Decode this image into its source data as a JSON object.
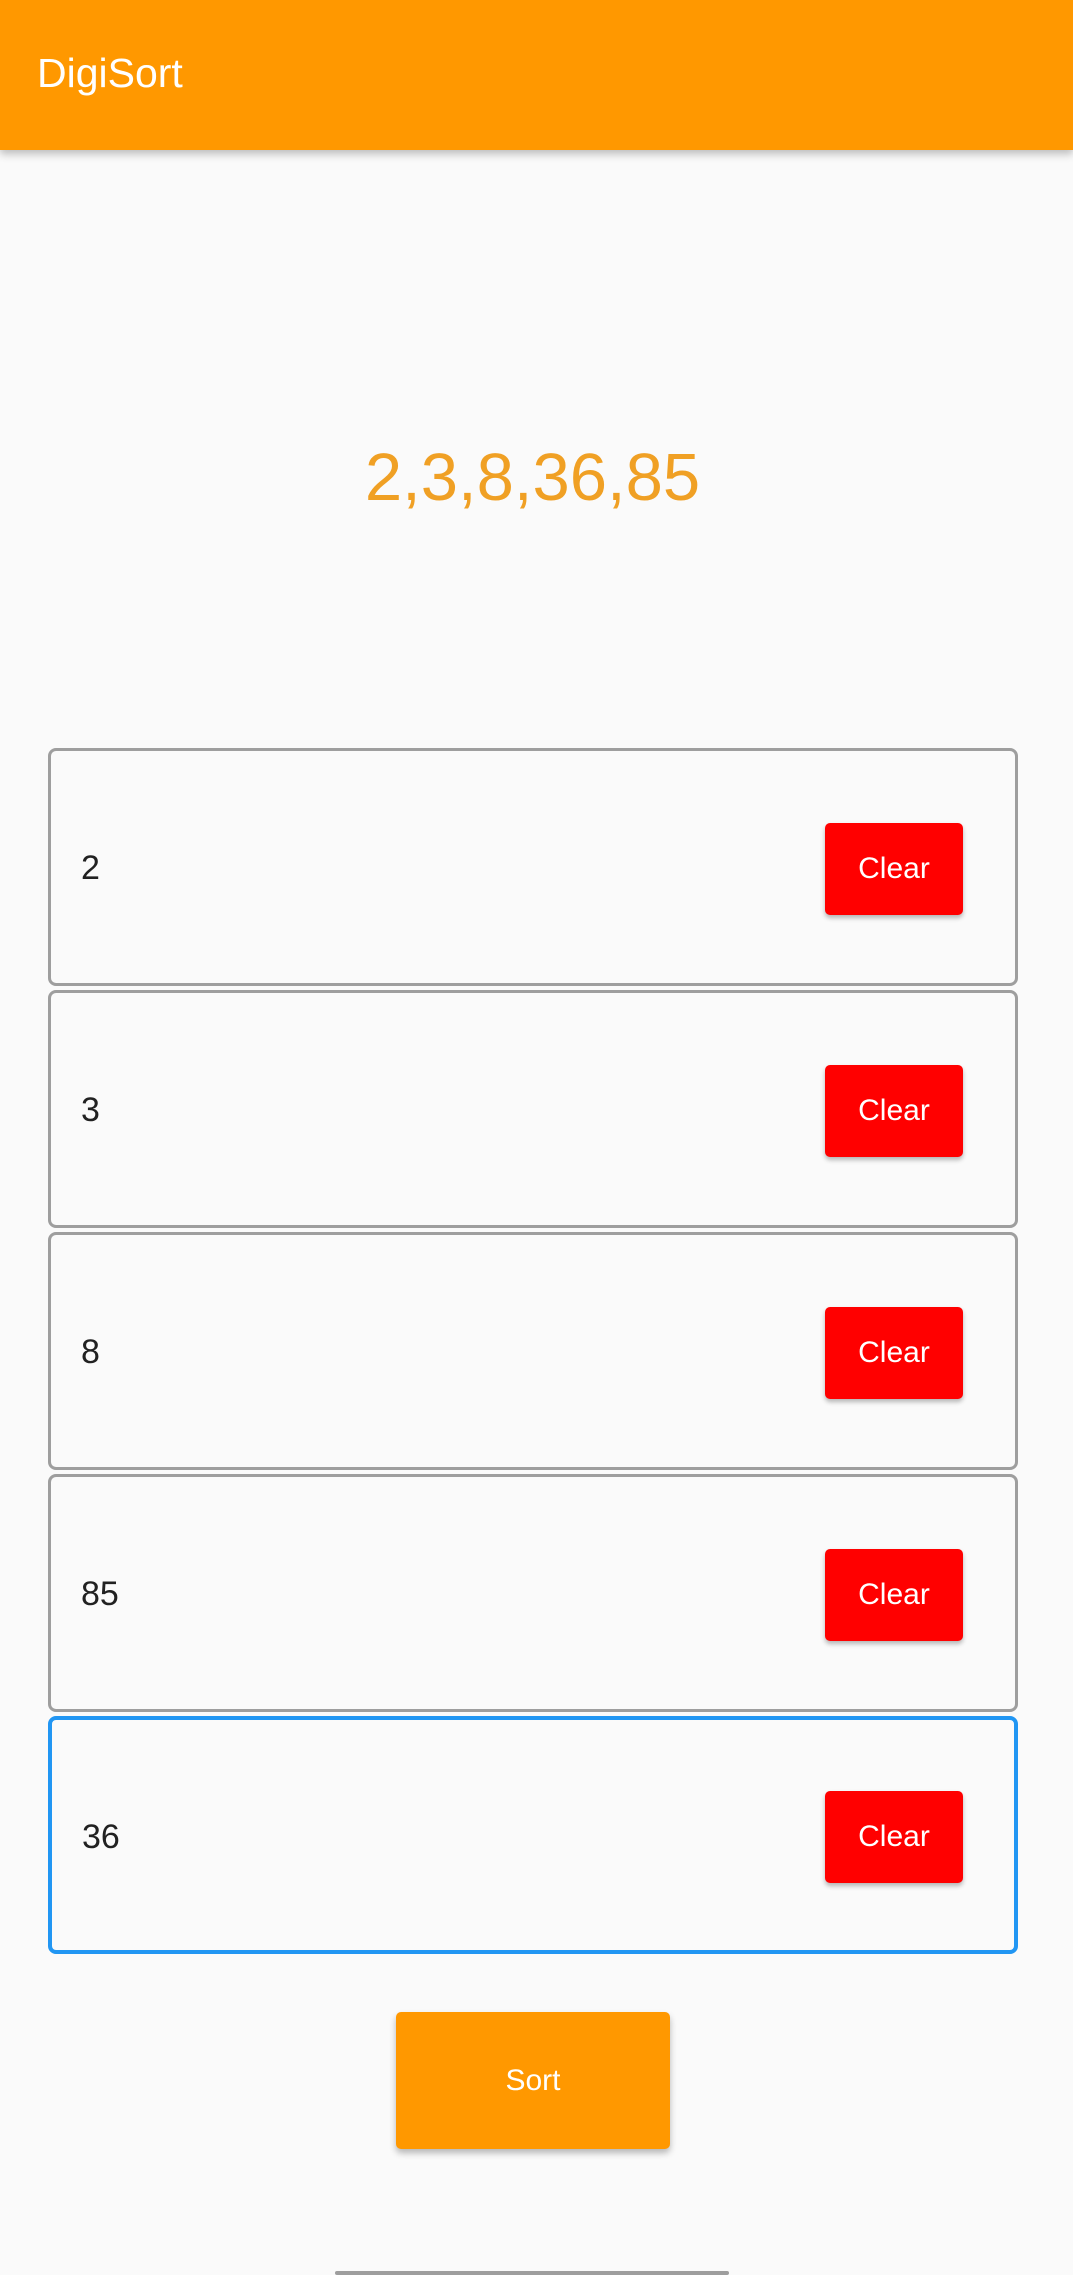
{
  "app_bar": {
    "title": "DigiSort",
    "color": "#ff9800"
  },
  "result": {
    "text": "2,3,8,36,85",
    "color": "#f0a024"
  },
  "inputs": [
    {
      "value": "2",
      "clear_label": "Clear"
    },
    {
      "value": "3",
      "clear_label": "Clear"
    },
    {
      "value": "8",
      "clear_label": "Clear"
    },
    {
      "value": "85",
      "clear_label": "Clear"
    },
    {
      "value": "36",
      "clear_label": "Clear",
      "focused": true
    }
  ],
  "sort_button": {
    "label": "Sort",
    "color": "#ff9800"
  },
  "colors": {
    "clear_button": "#ff0000",
    "focused_border": "#2196f3",
    "border": "#9e9e9e",
    "background": "#fafafa"
  }
}
